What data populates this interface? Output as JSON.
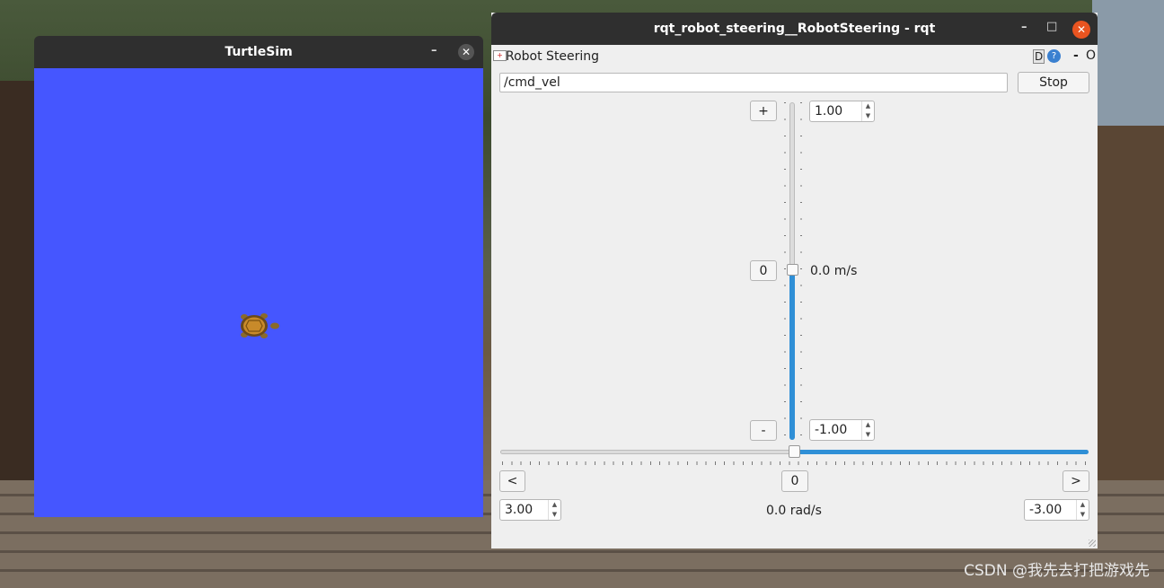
{
  "turtlesim": {
    "title": "TurtleSim",
    "min_glyph": "–",
    "close_glyph": "✕",
    "background_color": "#4556ff"
  },
  "rqt": {
    "title": "rqt_robot_steering__RobotSteering - rqt",
    "min_glyph": "–",
    "max_glyph": "□",
    "close_glyph": "✕",
    "plugin": {
      "title": "Robot Steering",
      "d_label": "D",
      "help_label": "?",
      "min_label": "-",
      "float_label": "O"
    },
    "topic": {
      "value": "/cmd_vel"
    },
    "stop_label": "Stop",
    "linear": {
      "plus_label": "+",
      "zero_label": "0",
      "minus_label": "-",
      "max_value": "1.00",
      "min_value": "-1.00",
      "current_label": "0.0 m/s",
      "slider_fraction": 0.5
    },
    "angular": {
      "left_label": "<",
      "zero_label": "0",
      "right_label": ">",
      "left_value": "3.00",
      "right_value": "-3.00",
      "current_label": "0.0 rad/s",
      "slider_fraction": 0.5
    },
    "accent_color": "#2f8fd6",
    "close_color": "#e95420"
  },
  "watermark": "CSDN @我先去打把游戏先"
}
